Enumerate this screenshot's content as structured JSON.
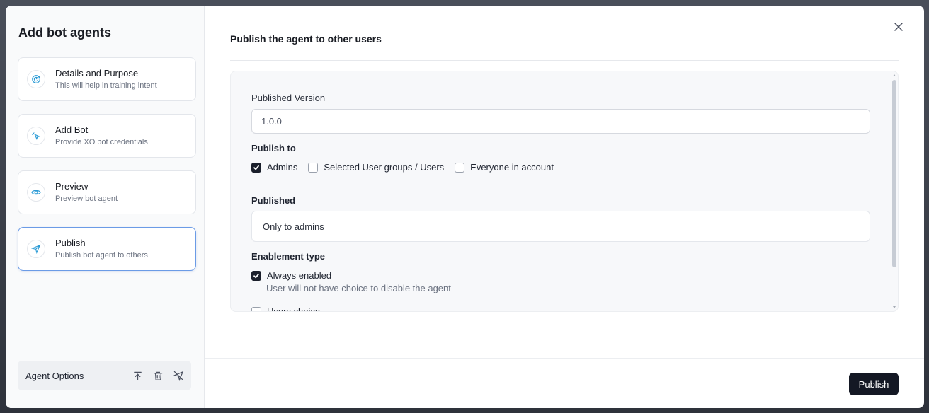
{
  "sidebar": {
    "title": "Add bot agents",
    "steps": [
      {
        "title": "Details and Purpose",
        "subtitle": "This will help in training intent",
        "icon": "target-icon"
      },
      {
        "title": "Add Bot",
        "subtitle": "Provide XO bot credentials",
        "icon": "pointer-click-icon"
      },
      {
        "title": "Preview",
        "subtitle": "Preview bot agent",
        "icon": "eye-icon"
      },
      {
        "title": "Publish",
        "subtitle": "Publish bot agent to others",
        "icon": "send-icon",
        "active": true
      }
    ],
    "agent_options": {
      "label": "Agent Options",
      "icons": [
        "upload-icon",
        "trash-icon",
        "unpublish-icon"
      ]
    }
  },
  "main": {
    "title": "Publish the agent to other users",
    "published_version": {
      "label": "Published Version",
      "value": "1.0.0"
    },
    "publish_to": {
      "label": "Publish to",
      "options": [
        {
          "label": "Admins",
          "checked": true
        },
        {
          "label": "Selected User groups / Users",
          "checked": false
        },
        {
          "label": "Everyone in account",
          "checked": false
        }
      ]
    },
    "published": {
      "label": "Published",
      "value": "Only to admins"
    },
    "enablement_type": {
      "label": "Enablement type",
      "options": [
        {
          "label": "Always enabled",
          "description": "User will not have choice to disable the agent",
          "checked": true
        },
        {
          "label": "Users choice",
          "checked": false
        }
      ]
    },
    "publish_button": "Publish"
  },
  "colors": {
    "accent": "#2b9bd6",
    "active_border": "#6b9be6",
    "button_bg": "#141824"
  }
}
